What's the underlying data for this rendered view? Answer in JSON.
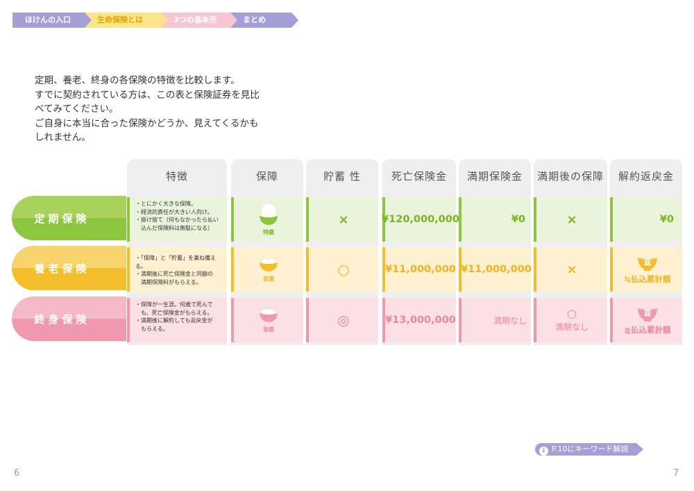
{
  "breadcrumb": [
    "ほけんの入口",
    "生命保険とは",
    "3つの基本形",
    "まとめ"
  ],
  "intro": [
    "定期、養老、終身の各保険の特徴を比較します。",
    "すでに契約されている方は、この表と保険証券を見比",
    "べてみてください。",
    "ご自身に本当に合った保険かどうか、見えてくるかも",
    "しれません。"
  ],
  "columns": [
    "特徴",
    "保障",
    "貯蓄 性",
    "死亡保険金",
    "満期保険金",
    "満期後の保障",
    "解約返戻金"
  ],
  "rows": [
    {
      "label": "定期保険",
      "features": [
        "・とにかく大きな保障。",
        "・経済的責任が大きい人向け。",
        "・掛け捨て（何もなかったら払い",
        "　込んだ保険料は無駄になる）"
      ],
      "bowl_label": "特盛",
      "savings": "×",
      "death_benefit": "¥120,000,000",
      "maturity_benefit": "¥0",
      "post_maturity": "×",
      "surrender": "¥0",
      "colors": {
        "main": "#8cc63f",
        "light": "#a9d25c",
        "cell": "#eaf3dc",
        "text": "#7ab51d"
      }
    },
    {
      "label": "養老保険",
      "features": [
        "・「保障」と「貯蓄」を兼ね備える。",
        "・満期後に死亡保険金と同額の",
        "　満期保険料がもらえる。"
      ],
      "bowl_label": "並盛",
      "savings": "○",
      "death_benefit": "¥11,000,000",
      "maturity_benefit": "¥11,000,000",
      "post_maturity": "×",
      "surrender_mark": "並",
      "surrender": "≒払込累計額",
      "colors": {
        "main": "#f3bd2b",
        "light": "#f7d36b",
        "cell": "#fdf1d1",
        "text": "#f0b41c"
      }
    },
    {
      "label": "終身保険",
      "features": [
        "・保障が一生涯。何歳で死んで",
        "　も、死亡保険金がもらえる。",
        "・満期後に解約しても返戻金が",
        "　もらえる。"
      ],
      "bowl_label": "並盛",
      "savings": "◎",
      "death_benefit": "¥13,000,000",
      "maturity_benefit": "満期なし",
      "post_maturity_mark": "○",
      "post_maturity": "満期なし",
      "surrender_mark": "並",
      "surrender": "≧払込累計額",
      "colors": {
        "main": "#f098ae",
        "light": "#f5b8c6",
        "cell": "#fbe0e6",
        "text": "#ec85a0"
      }
    }
  ],
  "footer_link": "P.10にキーワード解説",
  "info_icon": "i",
  "page_left": "6",
  "page_right": "7"
}
